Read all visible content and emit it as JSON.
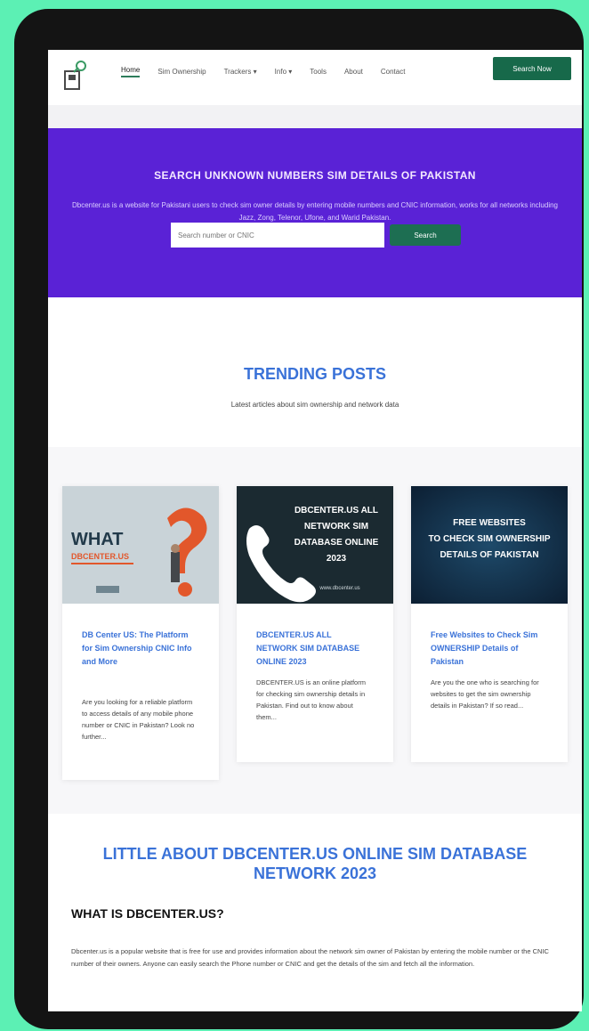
{
  "header": {
    "nav": [
      "Home",
      "Sim Ownership",
      "Trackers",
      "Info",
      "Tools",
      "About",
      "Contact"
    ],
    "cta_label": "Search Now"
  },
  "hero": {
    "title": "SEARCH UNKNOWN NUMBERS SIM DETAILS OF PAKISTAN",
    "description": "Dbcenter.us is a website for Pakistani users to check sim owner details by entering mobile numbers and CNIC information, works for all networks including Jazz, Zong, Telenor, Ufone, and Warid Pakistan.",
    "search_placeholder": "Search number or CNIC",
    "search_button": "Search"
  },
  "trending": {
    "title": "TRENDING POSTS",
    "subtitle": "Latest articles about sim ownership and network data"
  },
  "posts": [
    {
      "thumb_line1": "WHAT",
      "thumb_line2": "DBCENTER.US",
      "title": "DB Center US: The Platform for Sim Ownership CNIC Info and More",
      "excerpt": "Are you looking for a reliable platform to access details of any mobile phone number or CNIC in Pakistan? Look no further..."
    },
    {
      "thumb_line1": "DBCENTER.US ALL",
      "thumb_line2": "NETWORK SIM",
      "thumb_line3": "DATABASE ONLINE",
      "thumb_line4": "2023",
      "thumb_url": "www.dbcenter.us",
      "title": "DBCENTER.US ALL NETWORK SIM DATABASE ONLINE 2023",
      "excerpt": "DBCENTER.US is an online platform for checking sim ownership details in Pakistan. Find out to know about them..."
    },
    {
      "thumb_line1": "FREE WEBSITES",
      "thumb_line2": "TO CHECK SIM OWNERSHIP",
      "thumb_line3": "DETAILS OF PAKISTAN",
      "title": "Free Websites to Check Sim OWNERSHIP Details of Pakistan",
      "excerpt": "Are you the one who is searching for websites to get the sim ownership details in Pakistan? If so read..."
    }
  ],
  "about": {
    "title": "LITTLE ABOUT DBCENTER.US ONLINE SIM DATABASE NETWORK 2023",
    "heading": "WHAT IS DBCENTER.US?",
    "paragraph": "Dbcenter.us is a popular website that is free for use and provides information about the network sim owner of Pakistan by entering the mobile number or the CNIC number of their owners. Anyone can easily search the Phone number or CNIC and get the details of the sim and fetch all the information."
  },
  "colors": {
    "accent_green": "#17694a",
    "hero_purple": "#5a22d6",
    "link_blue": "#3a72d8",
    "background_mint": "#5cf0b4"
  }
}
